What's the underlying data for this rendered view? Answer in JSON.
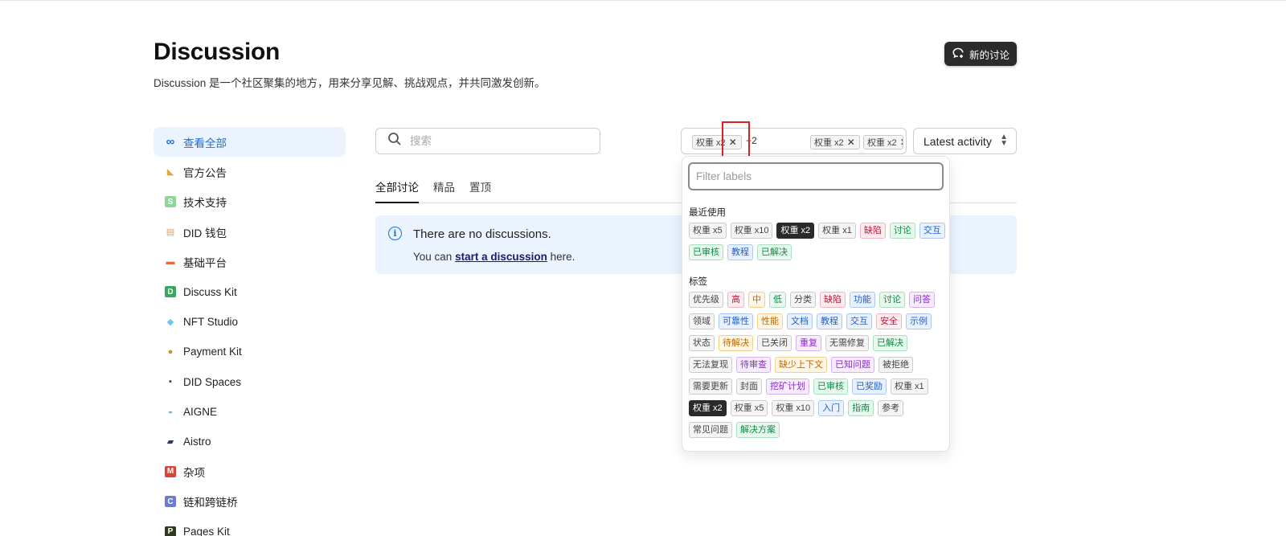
{
  "page": {
    "title": "Discussion",
    "description": "Discussion 是一个社区聚集的地方，用来分享见解、挑战观点，并共同激发创新。",
    "new_button": "新的讨论"
  },
  "sidebar": {
    "items": [
      {
        "label": "查看全部",
        "icon": "infinity-icon",
        "color": "#1e6fd6"
      },
      {
        "label": "官方公告",
        "icon": "megaphone-icon",
        "color": "#e8a33a"
      },
      {
        "label": "技术支持",
        "icon": "s-icon",
        "color": "#8fd694"
      },
      {
        "label": "DID 钱包",
        "icon": "wallet-icon",
        "color": "#d9a066"
      },
      {
        "label": "基础平台",
        "icon": "truck-icon",
        "color": "#e56a3b"
      },
      {
        "label": "Discuss Kit",
        "icon": "d-icon",
        "color": "#3aa85a"
      },
      {
        "label": "NFT Studio",
        "icon": "gem-icon",
        "color": "#6bc4f5"
      },
      {
        "label": "Payment Kit",
        "icon": "money-bag-icon",
        "color": "#c9962f"
      },
      {
        "label": "DID Spaces",
        "icon": "floppy-icon",
        "color": "#444444"
      },
      {
        "label": "AIGNE",
        "icon": "bowl-icon",
        "color": "#7aa7c7"
      },
      {
        "label": "Aistro",
        "icon": "night-sky-icon",
        "color": "#2a3b66"
      },
      {
        "label": "杂项",
        "icon": "m-icon",
        "color": "#d9443a"
      },
      {
        "label": "链和跨链桥",
        "icon": "c-icon",
        "color": "#6b7bd6"
      },
      {
        "label": "Pages Kit",
        "icon": "p-icon",
        "color": "#2f3a1f"
      }
    ]
  },
  "search": {
    "placeholder": "搜索"
  },
  "label_filter": {
    "chips": [
      "权重 x2",
      "权重 x2",
      "权重 x2"
    ],
    "more": "+2"
  },
  "sort": {
    "value": "Latest activity"
  },
  "tabs": [
    "全部讨论",
    "精品",
    "置顶"
  ],
  "notice": {
    "title": "There are no discussions.",
    "text_before": "You can ",
    "link": "start a discussion",
    "text_after": " here."
  },
  "dropdown": {
    "placeholder": "Filter labels",
    "recent_title": "最近使用",
    "recent": [
      {
        "label": "权重 x5",
        "style": "gray"
      },
      {
        "label": "权重 x10",
        "style": "gray"
      },
      {
        "label": "权重 x2",
        "style": "dark"
      },
      {
        "label": "权重 x1",
        "style": "gray"
      },
      {
        "label": "缺陷",
        "style": "red"
      },
      {
        "label": "讨论",
        "style": "green"
      },
      {
        "label": "交互",
        "style": "blue"
      },
      {
        "label": "已审核",
        "style": "green"
      },
      {
        "label": "教程",
        "style": "blue"
      },
      {
        "label": "已解决",
        "style": "green"
      }
    ],
    "tags_title": "标签",
    "tags": [
      {
        "label": "优先级",
        "style": "gray"
      },
      {
        "label": "高",
        "style": "red"
      },
      {
        "label": "中",
        "style": "orange"
      },
      {
        "label": "低",
        "style": "green"
      },
      {
        "label": "分类",
        "style": "gray"
      },
      {
        "label": "缺陷",
        "style": "red"
      },
      {
        "label": "功能",
        "style": "blue"
      },
      {
        "label": "讨论",
        "style": "green"
      },
      {
        "label": "问答",
        "style": "purple"
      },
      {
        "label": "领域",
        "style": "gray"
      },
      {
        "label": "可靠性",
        "style": "blue"
      },
      {
        "label": "性能",
        "style": "orange"
      },
      {
        "label": "文档",
        "style": "blue"
      },
      {
        "label": "教程",
        "style": "blue"
      },
      {
        "label": "交互",
        "style": "blue"
      },
      {
        "label": "安全",
        "style": "red"
      },
      {
        "label": "示例",
        "style": "blue"
      },
      {
        "label": "状态",
        "style": "gray"
      },
      {
        "label": "待解决",
        "style": "orange"
      },
      {
        "label": "已关闭",
        "style": "gray"
      },
      {
        "label": "重复",
        "style": "purple"
      },
      {
        "label": "无需修复",
        "style": "gray"
      },
      {
        "label": "已解决",
        "style": "green"
      },
      {
        "label": "无法复现",
        "style": "gray"
      },
      {
        "label": "待审查",
        "style": "purple"
      },
      {
        "label": "缺少上下文",
        "style": "orange"
      },
      {
        "label": "已知问题",
        "style": "purple"
      },
      {
        "label": "被拒绝",
        "style": "gray"
      },
      {
        "label": "需要更新",
        "style": "gray"
      },
      {
        "label": "封面",
        "style": "gray"
      },
      {
        "label": "挖矿计划",
        "style": "purple"
      },
      {
        "label": "已审核",
        "style": "green"
      },
      {
        "label": "已奖励",
        "style": "blue"
      },
      {
        "label": "权重 x1",
        "style": "gray"
      },
      {
        "label": "权重 x2",
        "style": "dark"
      },
      {
        "label": "权重 x5",
        "style": "gray"
      },
      {
        "label": "权重 x10",
        "style": "gray"
      },
      {
        "label": "入门",
        "style": "blue"
      },
      {
        "label": "指南",
        "style": "green"
      },
      {
        "label": "参考",
        "style": "gray"
      },
      {
        "label": "常见问题",
        "style": "gray"
      },
      {
        "label": "解决方案",
        "style": "green"
      }
    ]
  }
}
